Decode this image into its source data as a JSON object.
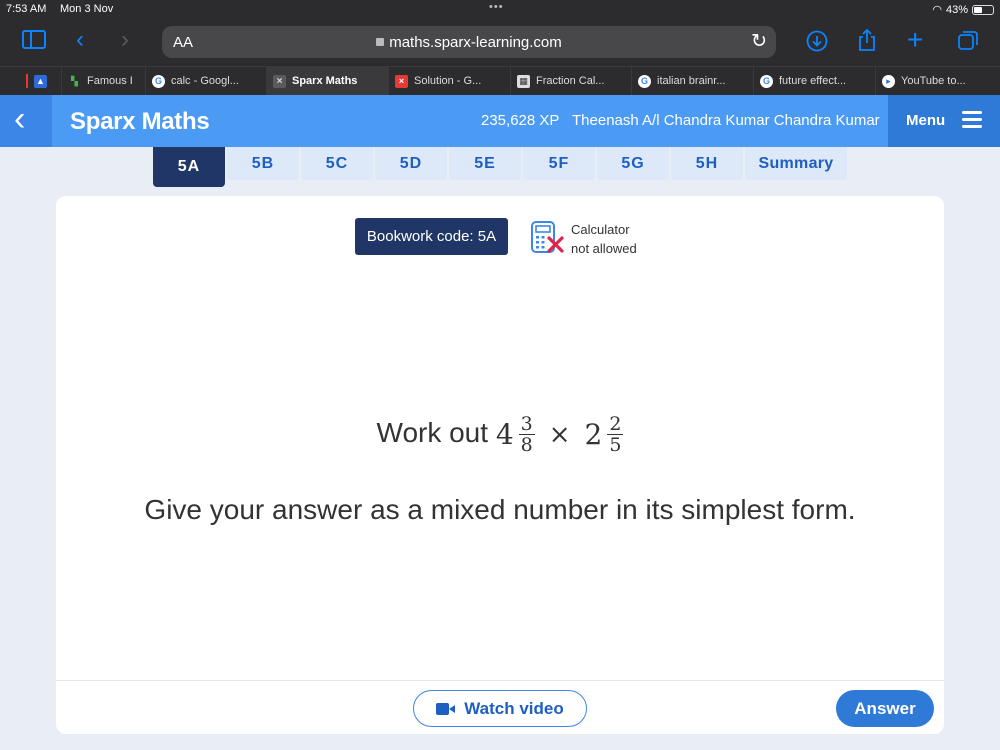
{
  "status_bar": {
    "time": "7:53 AM",
    "date": "Mon 3 Nov",
    "battery": "43%",
    "battery_level": 0.43
  },
  "browser": {
    "text_size_label": "AA",
    "url": "maths.sparx-learning.com",
    "icons": [
      "sidebar-icon",
      "back-icon",
      "forward-icon",
      "lock-icon",
      "reload-icon",
      "download-icon",
      "share-icon",
      "new-tab-icon",
      "tabs-icon"
    ],
    "tabs": [
      {
        "label": "Famous I"
      },
      {
        "label": "calc - Googl..."
      },
      {
        "label": "Sparx Maths"
      },
      {
        "label": "Solution - G..."
      },
      {
        "label": "Fraction Cal..."
      },
      {
        "label": "italian brainr..."
      },
      {
        "label": "future effect..."
      },
      {
        "label": "YouTube to..."
      }
    ]
  },
  "header": {
    "brand": "Sparx Maths",
    "xp": "235,628 XP",
    "user_name": "Theenash A/l Chandra Kumar Chandra Kumar",
    "menu_label": "Menu",
    "accent": "#4b9af3",
    "dark": "#1f3666"
  },
  "task_tabs": [
    "5A",
    "5B",
    "5C",
    "5D",
    "5E",
    "5F",
    "5G",
    "5H",
    "Summary"
  ],
  "active_task": "5A",
  "question": {
    "bookwork": "Bookwork code: 5A",
    "calculator_line1": "Calculator",
    "calculator_line2": "not allowed",
    "prompt": "Work out",
    "term1": {
      "whole": "4",
      "num": "3",
      "den": "8"
    },
    "operator": "×",
    "term2": {
      "whole": "2",
      "num": "2",
      "den": "5"
    },
    "instruction": "Give your answer as a mixed number in its simplest form."
  },
  "actions": {
    "watch_video": "Watch video",
    "answer": "Answer"
  }
}
